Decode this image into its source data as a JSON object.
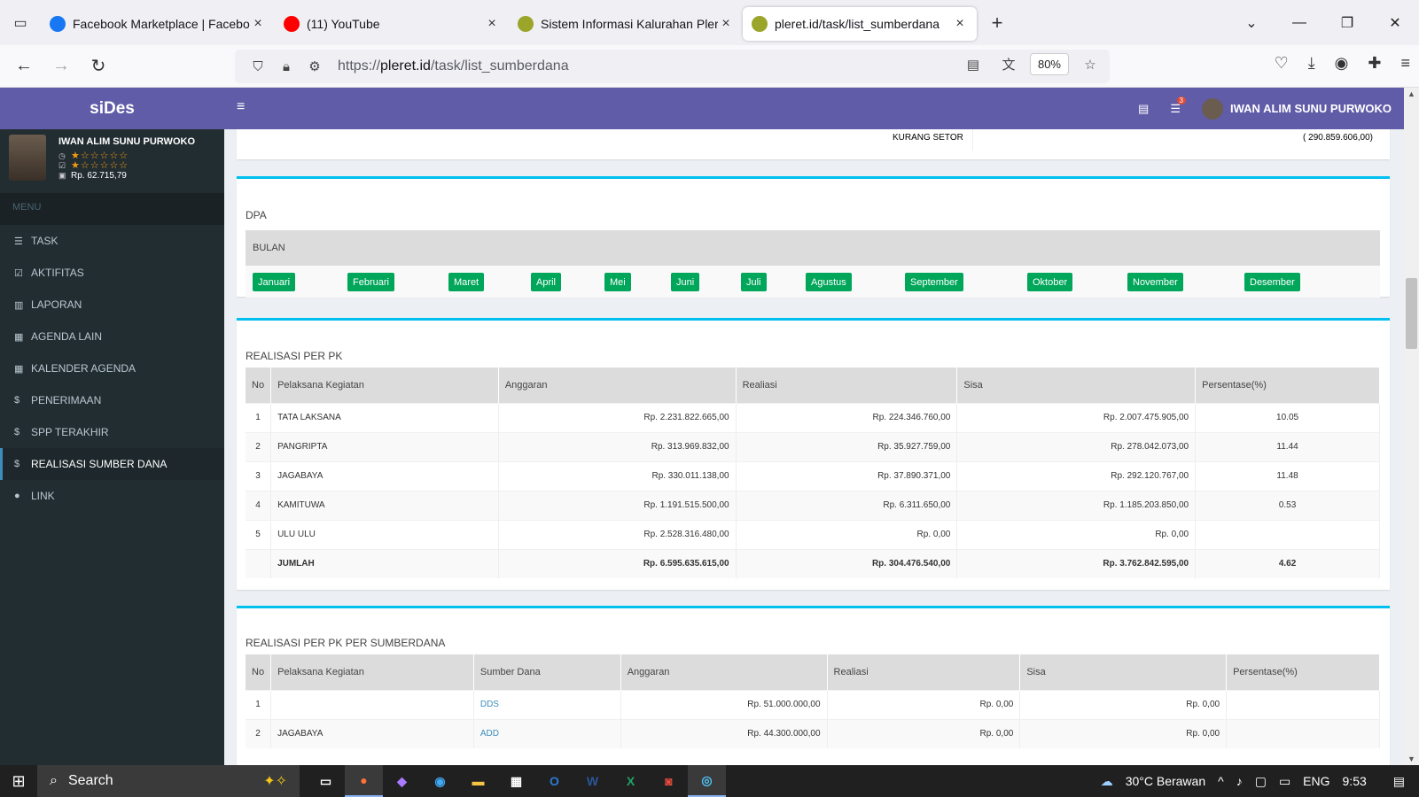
{
  "browser": {
    "tabs": [
      {
        "title": "Facebook Marketplace | Facebo",
        "favicon": "facebook-icon",
        "color": "#1877f2"
      },
      {
        "title": "(11) YouTube",
        "favicon": "youtube-icon",
        "color": "#ff0000"
      },
      {
        "title": "Sistem Informasi Kalurahan Pler",
        "favicon": "site-icon",
        "color": "#9aa52a"
      },
      {
        "title": "pleret.id/task/list_sumberdana",
        "favicon": "site-icon",
        "color": "#9aa52a"
      }
    ],
    "url_prefix": "https://",
    "url_domain": "pleret.id",
    "url_path": "/task/list_sumberdana",
    "zoom": "80%"
  },
  "app": {
    "brand": "siDes",
    "user": {
      "name": "IWAN ALIM SUNU PURWOKO",
      "stars1": "★☆☆☆☆☆",
      "stars2": "★☆☆☆☆☆",
      "balance": "Rp. 62.715,79"
    },
    "menu_header": "MENU",
    "menu": [
      {
        "label": "TASK",
        "icon": "list-icon",
        "glyph": "☰"
      },
      {
        "label": "AKTIFITAS",
        "icon": "check-square-icon",
        "glyph": "☑"
      },
      {
        "label": "LAPORAN",
        "icon": "bar-chart-icon",
        "glyph": "▥"
      },
      {
        "label": "AGENDA LAIN",
        "icon": "calendar-icon",
        "glyph": "▦"
      },
      {
        "label": "KALENDER AGENDA",
        "icon": "calendar-icon",
        "glyph": "▦"
      },
      {
        "label": "PENERIMAAN",
        "icon": "dollar-icon",
        "glyph": "$"
      },
      {
        "label": "SPP TERAKHIR",
        "icon": "dollar-icon",
        "glyph": "$"
      },
      {
        "label": "REALISASI SUMBER DANA",
        "icon": "dollar-icon",
        "glyph": "$"
      },
      {
        "label": "LINK",
        "icon": "globe-icon",
        "glyph": "●"
      }
    ],
    "topbar": {
      "badge": "3",
      "user": "IWAN ALIM SUNU PURWOKO"
    }
  },
  "kurang_setor": {
    "label": "KURANG SETOR",
    "value": "( 290.859.606,00)"
  },
  "dpa": {
    "title": "DPA",
    "bulan_header": "BULAN",
    "months": [
      "Januari",
      "Februari",
      "Maret",
      "April",
      "Mei",
      "Juni",
      "Juli",
      "Agustus",
      "September",
      "Oktober",
      "November",
      "Desember"
    ]
  },
  "realisasi_pk": {
    "title": "REALISASI PER PK",
    "headers": [
      "No",
      "Pelaksana Kegiatan",
      "Anggaran",
      "Realiasi",
      "Sisa",
      "Persentase(%)"
    ],
    "rows": [
      [
        "1",
        "TATA LAKSANA",
        "Rp. 2.231.822.665,00",
        "Rp. 224.346.760,00",
        "Rp. 2.007.475.905,00",
        "10.05"
      ],
      [
        "2",
        "PANGRIPTA",
        "Rp. 313.969.832,00",
        "Rp. 35.927.759,00",
        "Rp. 278.042.073,00",
        "11.44"
      ],
      [
        "3",
        "JAGABAYA",
        "Rp. 330.011.138,00",
        "Rp. 37.890.371,00",
        "Rp. 292.120.767,00",
        "11.48"
      ],
      [
        "4",
        "KAMITUWA",
        "Rp. 1.191.515.500,00",
        "Rp. 6.311.650,00",
        "Rp. 1.185.203.850,00",
        "0.53"
      ],
      [
        "5",
        "ULU ULU",
        "Rp. 2.528.316.480,00",
        "Rp. 0,00",
        "Rp. 0,00",
        ""
      ]
    ],
    "total": [
      "",
      "JUMLAH",
      "Rp. 6.595.635.615,00",
      "Rp. 304.476.540,00",
      "Rp. 3.762.842.595,00",
      "4.62"
    ]
  },
  "realisasi_sd": {
    "title": "REALISASI PER PK PER SUMBERDANA",
    "headers": [
      "No",
      "Pelaksana Kegiatan",
      "Sumber Dana",
      "Anggaran",
      "Realiasi",
      "Sisa",
      "Persentase(%)"
    ],
    "rows": [
      [
        "1",
        "",
        "DDS",
        "Rp. 51.000.000,00",
        "Rp. 0,00",
        "Rp. 0,00",
        ""
      ],
      [
        "2",
        "JAGABAYA",
        "ADD",
        "Rp. 44.300.000,00",
        "Rp. 0,00",
        "Rp. 0,00",
        ""
      ]
    ]
  },
  "taskbar": {
    "search": "Search",
    "weather": "30°C  Berawan",
    "lang": "ENG",
    "time": "9:53"
  }
}
